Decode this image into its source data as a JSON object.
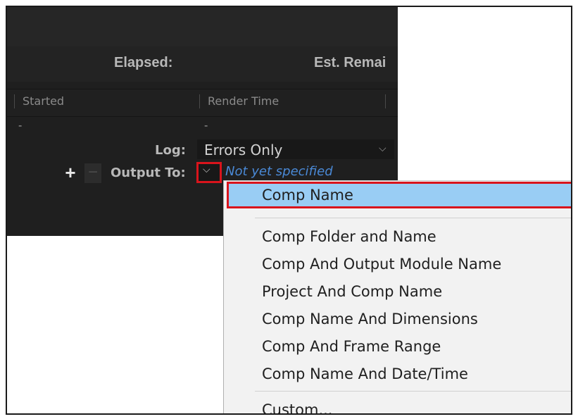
{
  "stats": {
    "elapsed_label": "Elapsed:",
    "est_remaining_label": "Est. Remai"
  },
  "columns": [
    "Started",
    "Render Time"
  ],
  "row_values": [
    "-",
    "-"
  ],
  "log": {
    "label": "Log:",
    "value": "Errors Only",
    "dropdown_icon": "chevron-down-icon"
  },
  "output": {
    "label": "Output To:",
    "value": "Not yet specified",
    "add_symbol": "+",
    "remove_symbol": "−",
    "dropdown_icon": "chevron-down-icon"
  },
  "menu": {
    "selected": "Comp Name",
    "items": [
      "Comp Name",
      "Comp Folder and Name",
      "Comp And Output Module Name",
      "Project And Comp Name",
      "Comp Name And Dimensions",
      "Comp And Frame Range",
      "Comp Name And Date/Time",
      "Custom..."
    ]
  },
  "colors": {
    "highlight_outline": "#d9141c",
    "selected_bg": "#99cdf4",
    "link_blue": "#4a89d6",
    "panel_bg": "#1f1f1f"
  }
}
